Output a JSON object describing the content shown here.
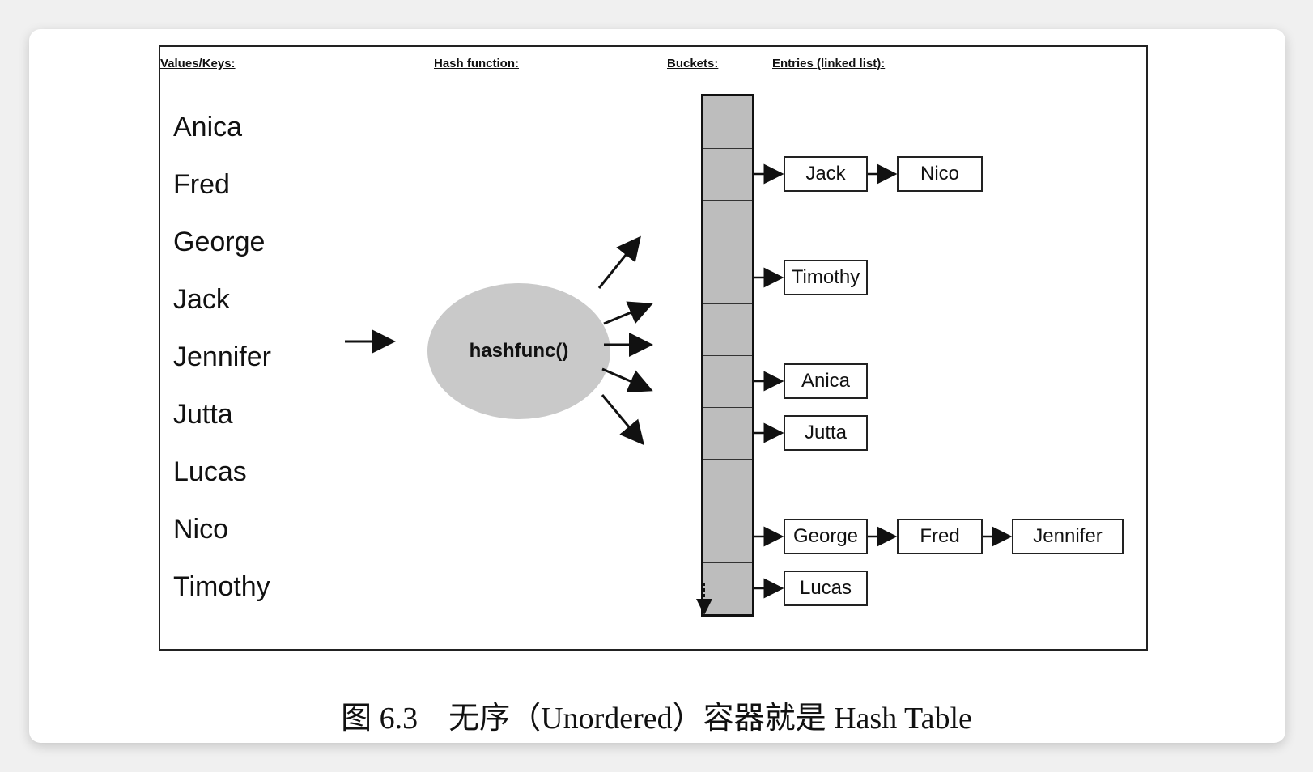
{
  "headers": {
    "values_keys": "Values/Keys:",
    "hash_function": "Hash function:",
    "buckets": "Buckets:",
    "entries": "Entries (linked list):"
  },
  "keys": [
    "Anica",
    "Fred",
    "George",
    "Jack",
    "Jennifer",
    "Jutta",
    "Lucas",
    "Nico",
    "Timothy"
  ],
  "hash_label": "hashfunc()",
  "bucket_count": 10,
  "chains": [
    {
      "bucket": 1,
      "entries": [
        "Jack",
        "Nico"
      ]
    },
    {
      "bucket": 3,
      "entries": [
        "Timothy"
      ]
    },
    {
      "bucket": 5,
      "entries": [
        "Anica"
      ]
    },
    {
      "bucket": 6,
      "entries": [
        "Jutta"
      ]
    },
    {
      "bucket": 8,
      "entries": [
        "George",
        "Fred",
        "Jennifer"
      ]
    },
    {
      "bucket": 9,
      "entries": [
        "Lucas"
      ]
    }
  ],
  "caption": "图 6.3　无序（Unordered）容器就是 Hash Table"
}
